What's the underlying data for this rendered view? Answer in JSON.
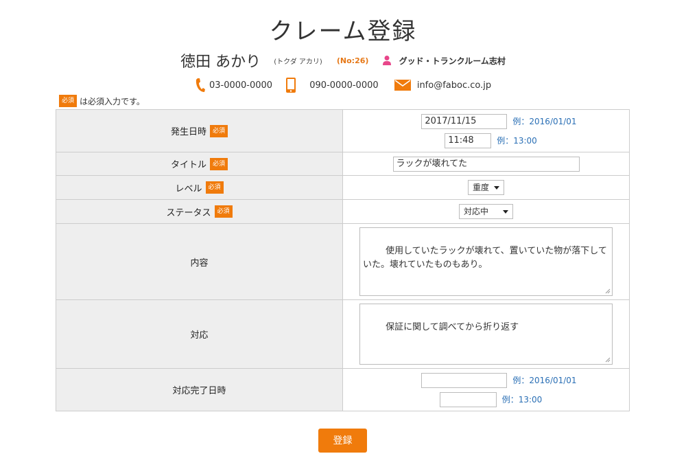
{
  "page": {
    "title": "クレーム登録"
  },
  "customer": {
    "name": "徳田 あかり",
    "kana": "(トクダ アカリ)",
    "number": "(No:26)",
    "company": "グッド・トランクルーム志村"
  },
  "contact": {
    "phone": "03-0000-0000",
    "mobile": "090-0000-0000",
    "email": "info@faboc.co.jp"
  },
  "required": {
    "badge": "必須",
    "note": "は必須入力です。"
  },
  "form": {
    "occurred": {
      "label": "発生日時",
      "date_value": "2017/11/15",
      "date_example": "例：2016/01/01",
      "time_value": "11:48",
      "time_example": "例：13:00"
    },
    "title": {
      "label": "タイトル",
      "value": "ラックが壊れてた"
    },
    "level": {
      "label": "レベル",
      "value": "重度"
    },
    "status": {
      "label": "ステータス",
      "value": "対応中"
    },
    "content": {
      "label": "内容",
      "value": "使用していたラックが壊れて、置いていた物が落下していた。壊れていたものもあり。"
    },
    "response": {
      "label": "対応",
      "value": "保証に関して調べてから折り返す"
    },
    "completed": {
      "label": "対応完了日時",
      "date_value": "",
      "date_example": "例：2016/01/01",
      "time_value": "",
      "time_example": "例：13:00"
    }
  },
  "actions": {
    "submit_label": "登録"
  },
  "colors": {
    "accent": "#f07b0c",
    "example_text": "#2a6fb5",
    "label_bg": "#eeeeee"
  }
}
